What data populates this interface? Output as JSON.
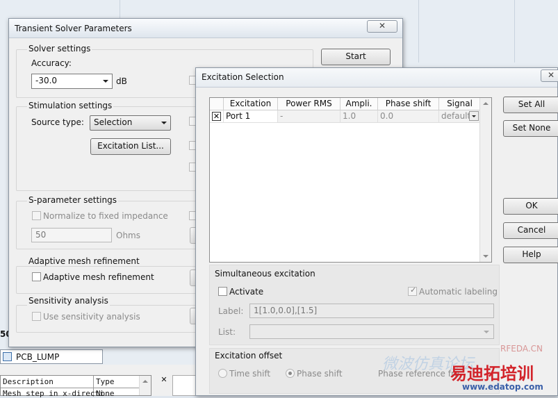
{
  "main_dialog": {
    "title": "Transient Solver Parameters",
    "close_glyph": "✕",
    "solver_settings": {
      "group_label": "Solver settings",
      "accuracy_label": "Accuracy:",
      "accuracy_value": "-30.0",
      "accuracy_unit": "dB",
      "start_button": "Start"
    },
    "stimulation_settings": {
      "group_label": "Stimulation settings",
      "source_type_label": "Source type:",
      "source_type_value": "Selection",
      "excitation_list_button": "Excitation List..."
    },
    "sparameter_settings": {
      "group_label": "S-parameter settings",
      "normalize_label": "Normalize to fixed impedance",
      "impedance_value": "50",
      "impedance_unit": "Ohms"
    },
    "adaptive_mesh": {
      "group_label": "Adaptive mesh refinement",
      "checkbox_label": "Adaptive mesh refinement"
    },
    "sensitivity": {
      "group_label": "Sensitivity analysis",
      "checkbox_label": "Use sensitivity analysis"
    }
  },
  "excitation_dialog": {
    "title": "Excitation Selection",
    "close_glyph": "✕",
    "columns": [
      "Excitation",
      "Power RMS",
      "Ampli.",
      "Phase shift",
      "Signal"
    ],
    "rows": [
      {
        "checked": true,
        "excitation": "Port 1",
        "power_rms": "-",
        "ampli": "1.0",
        "phase_shift": "0.0",
        "signal": "default"
      }
    ],
    "buttons": {
      "set_all": "Set All",
      "set_none": "Set None",
      "ok": "OK",
      "cancel": "Cancel",
      "help": "Help"
    },
    "simultaneous_excitation": {
      "group_label": "Simultaneous excitation",
      "activate_label": "Activate",
      "automatic_labeling_label": "Automatic labeling",
      "label_field_label": "Label:",
      "label_field_value": "1[1.0,0.0],[1.5]",
      "list_field_label": "List:",
      "list_field_value": ""
    },
    "excitation_offset": {
      "group_label": "Excitation offset",
      "time_shift_label": "Time shift",
      "phase_shift_label": "Phase shift",
      "phase_reference_label": "Phase reference fre"
    }
  },
  "background": {
    "tab_label": "PCB_LUMP",
    "side_number": "50",
    "table_headers": [
      "Description",
      "Type"
    ],
    "table_row": [
      "Mesh step in x-directi",
      "None"
    ]
  },
  "watermark": {
    "site_code": "RFEDA.CN",
    "brand": "易迪拓培训",
    "url": "www.edatop.com",
    "faint_text": "微波仿真论坛"
  },
  "colors": {
    "window_bg": "#f0f0f0",
    "watermark_red": "#d2232a"
  }
}
